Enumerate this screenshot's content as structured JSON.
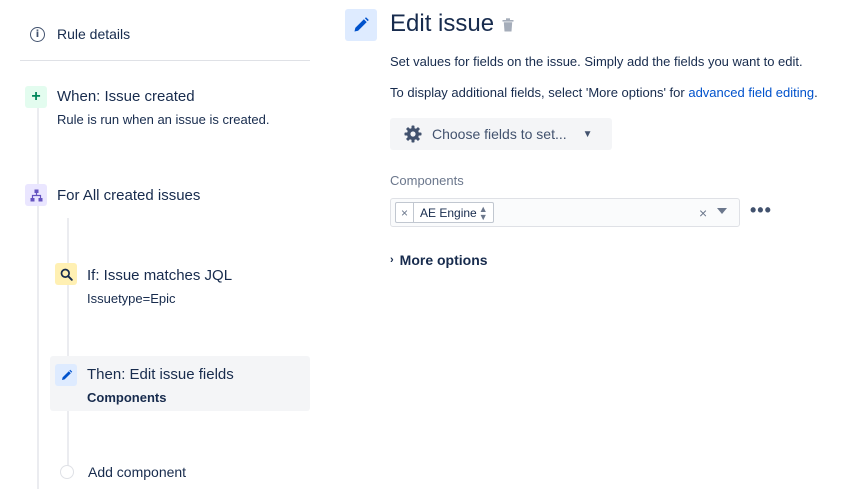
{
  "sidebar": {
    "rule_details": "Rule details",
    "trigger": {
      "title": "When: Issue created",
      "subtitle": "Rule is run when an issue is created."
    },
    "branch": {
      "title": "For All created issues"
    },
    "condition": {
      "title": "If: Issue matches JQL",
      "subtitle": "Issuetype=Epic"
    },
    "action": {
      "title": "Then: Edit issue fields",
      "subtitle": "Components"
    },
    "add_component": "Add component"
  },
  "main": {
    "title": "Edit issue",
    "desc1": "Set values for fields on the issue. Simply add the fields you want to edit.",
    "desc2_prefix": "To display additional fields, select 'More options' for ",
    "desc2_link": "advanced field editing",
    "desc2_suffix": ".",
    "choose_fields": "Choose fields to set...",
    "components_label": "Components",
    "component_chip": "AE Engine",
    "more_options": "More options"
  },
  "icons": {
    "info": "info-icon",
    "plus": "plus-icon",
    "branch": "branch-icon",
    "search": "search-icon",
    "pencil": "pencil-icon",
    "trash": "trash-icon",
    "gear": "gear-icon"
  },
  "colors": {
    "link": "#0052cc",
    "text": "#172b4d",
    "trigger_bg": "#e3fcef",
    "branch_bg": "#eae6ff",
    "condition_bg": "#fff0b3",
    "action_bg": "#deebff"
  }
}
